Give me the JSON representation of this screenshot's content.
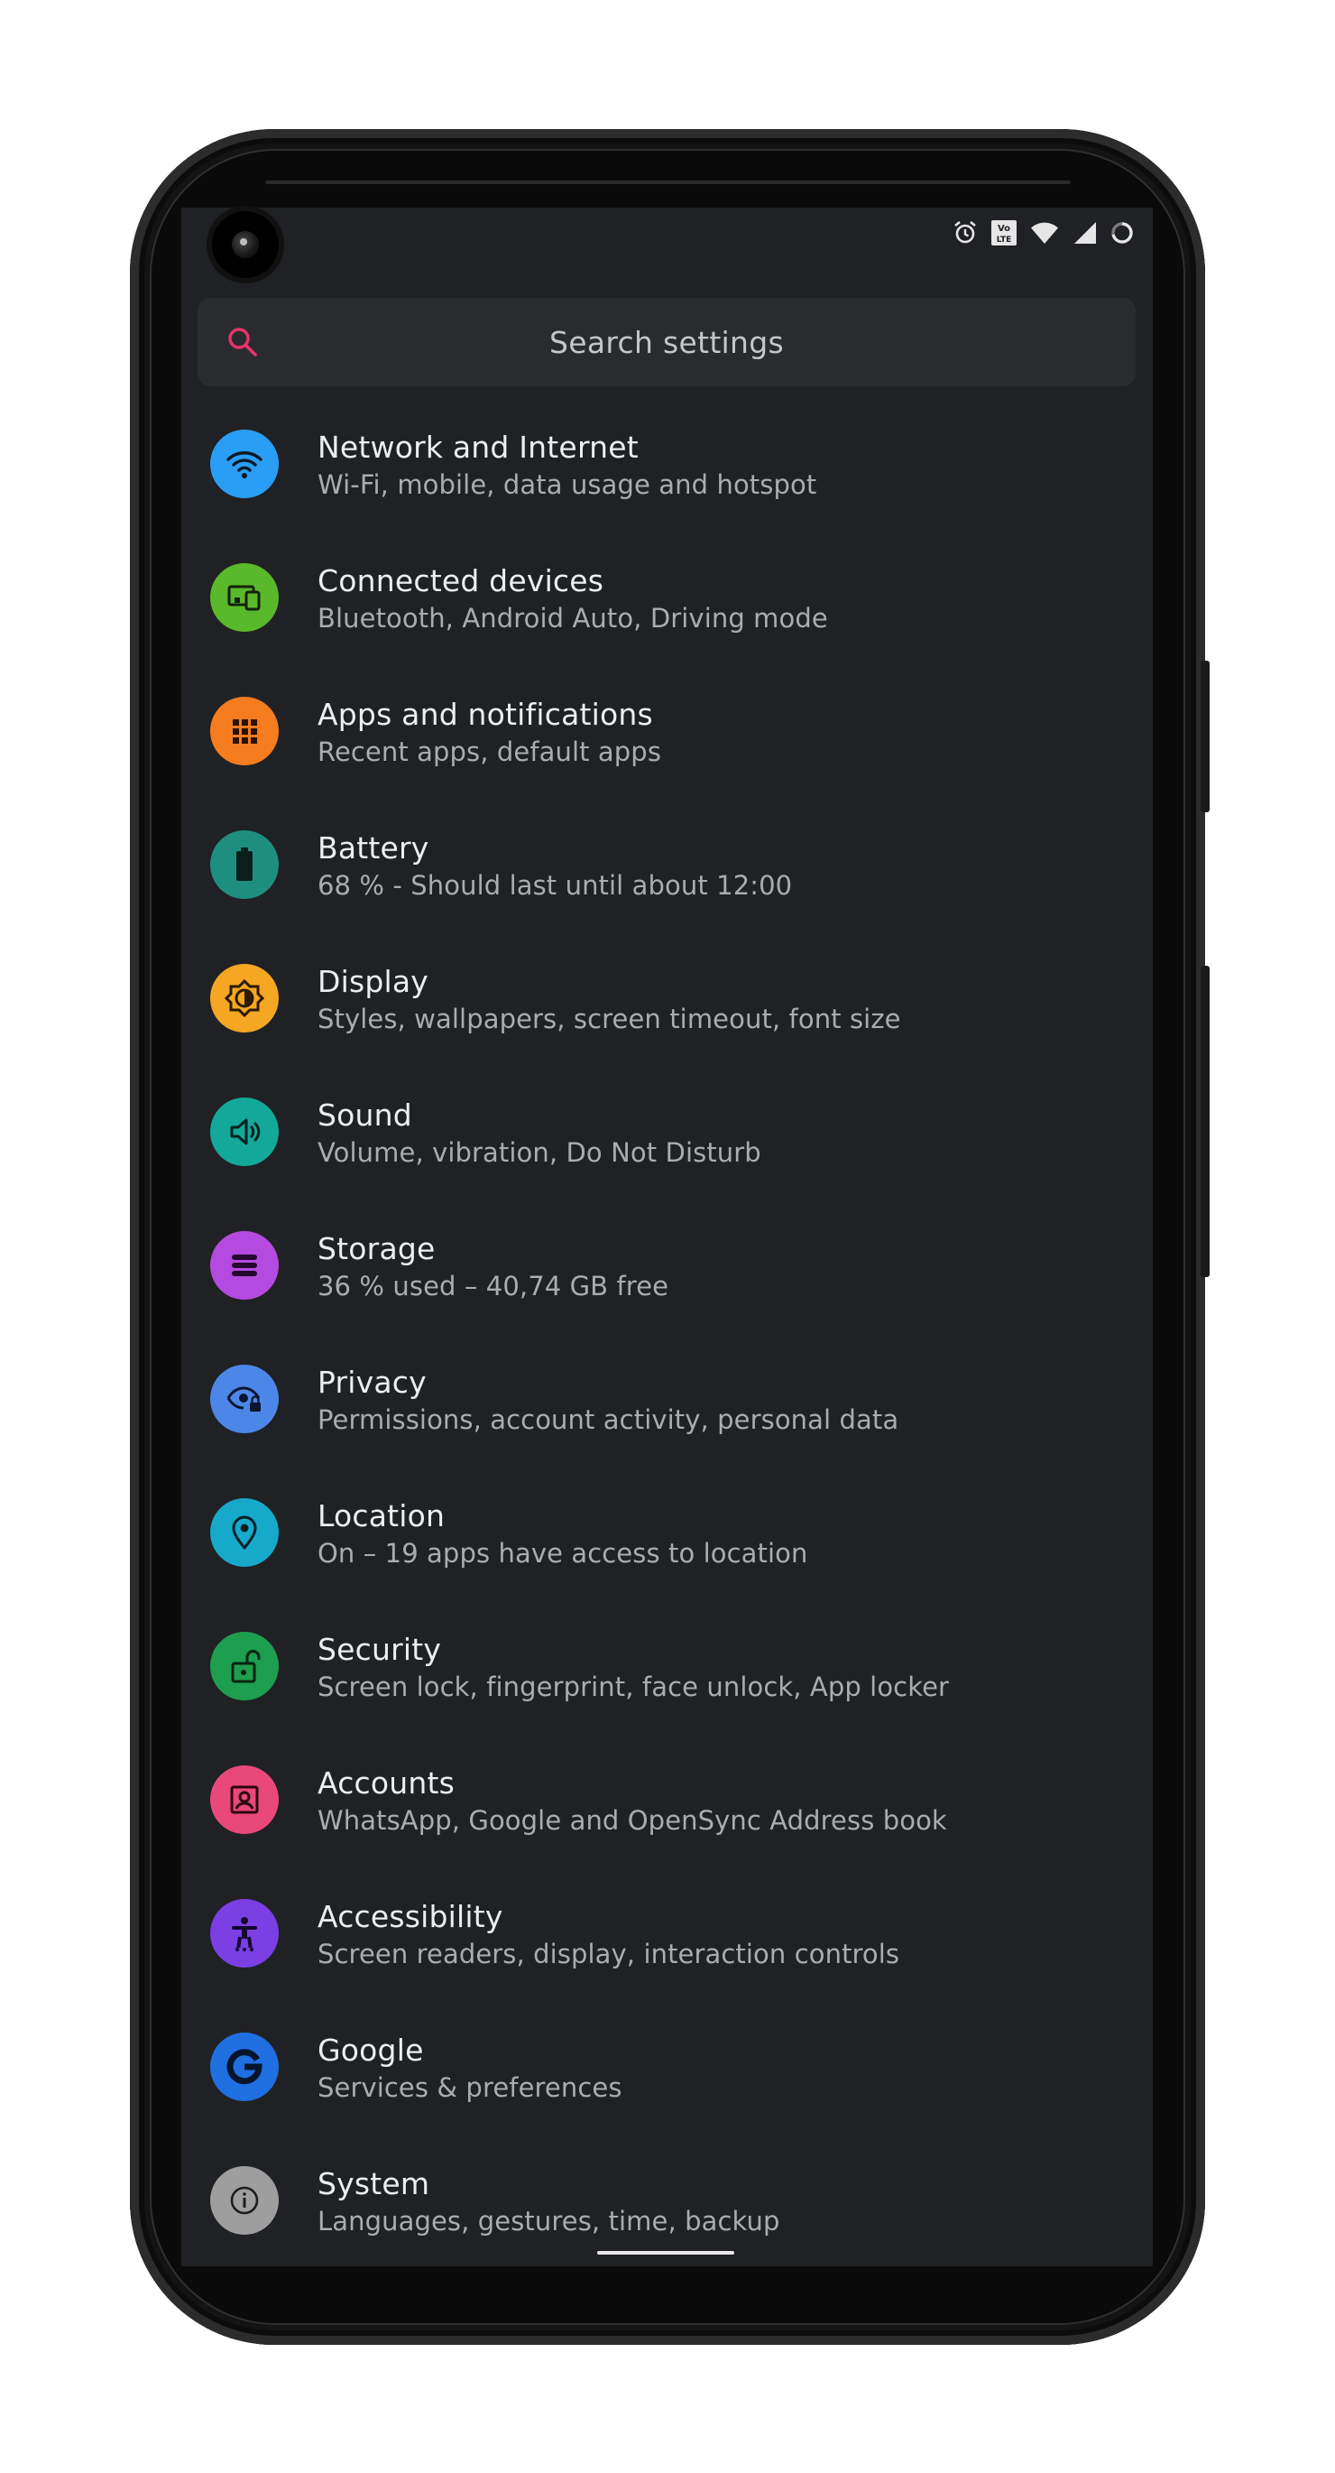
{
  "search": {
    "placeholder": "Search settings"
  },
  "colors": {
    "background": "#202124",
    "search_accent": "#e8336b",
    "title_text": "#eceef0",
    "subtitle_text": "#a9acb0"
  },
  "settings": [
    {
      "title": "Network and Internet",
      "subtitle": "Wi-Fi, mobile, data usage and hotspot",
      "icon": "wifi-icon",
      "color": "#2a9df4"
    },
    {
      "title": "Connected devices",
      "subtitle": "Bluetooth, Android Auto, Driving mode",
      "icon": "devices-icon",
      "color": "#5ab82b"
    },
    {
      "title": "Apps and notifications",
      "subtitle": "Recent apps, default apps",
      "icon": "apps-grid-icon",
      "color": "#f57c1f"
    },
    {
      "title": "Battery",
      "subtitle": "68 % - Should last until about 12:00",
      "icon": "battery-icon",
      "color": "#1e8f7e"
    },
    {
      "title": "Display",
      "subtitle": "Styles, wallpapers, screen timeout, font size",
      "icon": "brightness-icon",
      "color": "#f5a623"
    },
    {
      "title": "Sound",
      "subtitle": "Volume, vibration, Do Not Disturb",
      "icon": "volume-icon",
      "color": "#14a89a"
    },
    {
      "title": "Storage",
      "subtitle": "36 % used – 40,74 GB free",
      "icon": "storage-icon",
      "color": "#b44ae0"
    },
    {
      "title": "Privacy",
      "subtitle": "Permissions, account activity, personal data",
      "icon": "privacy-eye-icon",
      "color": "#4c87e8"
    },
    {
      "title": "Location",
      "subtitle": "On – 19 apps have access to location",
      "icon": "location-pin-icon",
      "color": "#17a9c9"
    },
    {
      "title": "Security",
      "subtitle": "Screen lock, fingerprint, face unlock, App locker",
      "icon": "unlock-icon",
      "color": "#1e9e4f"
    },
    {
      "title": "Accounts",
      "subtitle": "WhatsApp, Google and OpenSync Address book",
      "icon": "account-box-icon",
      "color": "#e8487a"
    },
    {
      "title": "Accessibility",
      "subtitle": "Screen readers, display, interaction controls",
      "icon": "accessibility-icon",
      "color": "#7b3fe4"
    },
    {
      "title": "Google",
      "subtitle": "Services & preferences",
      "icon": "google-g-icon",
      "color": "#1f6fe0"
    },
    {
      "title": "System",
      "subtitle": "Languages, gestures, time, backup",
      "icon": "info-icon",
      "color": "#9e9e9e"
    }
  ]
}
